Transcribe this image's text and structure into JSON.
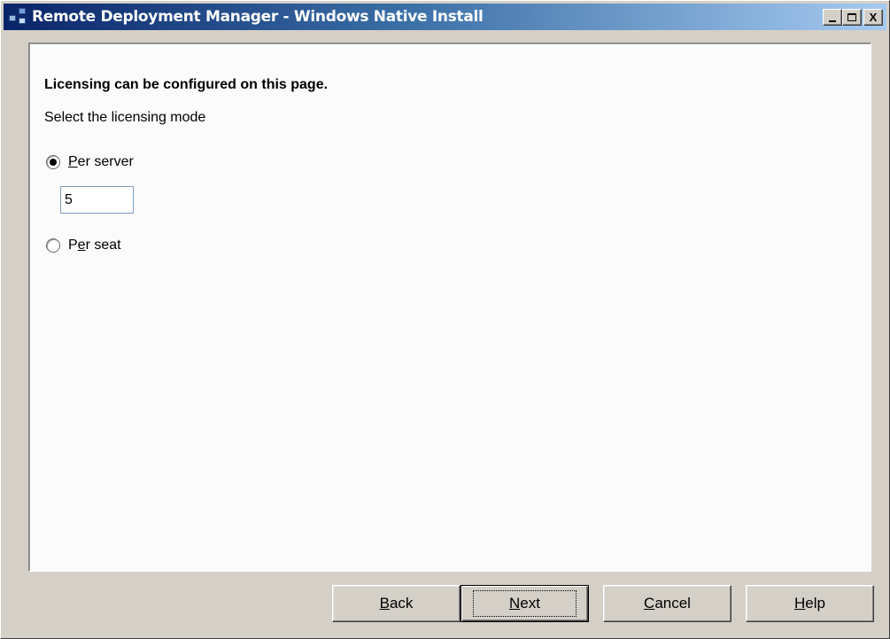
{
  "window": {
    "title": "Remote Deployment Manager - Windows Native Install",
    "controls": {
      "minimize": "_",
      "maximize": "□",
      "close": "X"
    }
  },
  "content": {
    "heading": "Licensing can be configured on this page.",
    "instruction": "Select the licensing mode",
    "options": [
      {
        "label": "Per server",
        "mnemonic": "P",
        "rest": "er server",
        "selected": true
      },
      {
        "label": "Per seat",
        "pre": "P",
        "mnemonic": "e",
        "rest": "r seat",
        "selected": false
      }
    ],
    "license_count": "5"
  },
  "buttons": {
    "back": {
      "mnemonic": "B",
      "rest": "ack"
    },
    "next": {
      "mnemonic": "N",
      "rest": "ext"
    },
    "cancel": {
      "mnemonic": "C",
      "rest": "ancel"
    },
    "help": {
      "mnemonic": "H",
      "rest": "elp"
    }
  }
}
